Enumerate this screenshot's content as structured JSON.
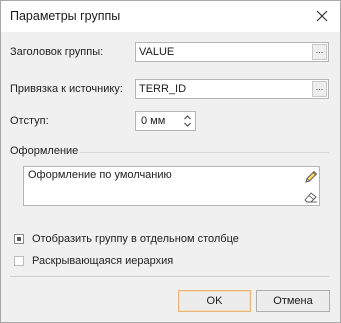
{
  "window": {
    "title": "Параметры группы"
  },
  "form": {
    "group_header": {
      "label": "Заголовок группы:",
      "value": "VALUE",
      "button": "..."
    },
    "source_binding": {
      "label": "Привязка к источнику:",
      "value": "TERR_ID",
      "button": "..."
    },
    "indent": {
      "label": "Отступ:",
      "value": "0 мм"
    },
    "appearance": {
      "section_label": "Оформление",
      "value": "Оформление по умолчанию"
    },
    "show_in_separate_column": {
      "label": "Отобразить группу в отдельном столбце",
      "checked": true
    },
    "expandable_hierarchy": {
      "label": "Раскрывающаяся иерархия",
      "checked": false
    }
  },
  "buttons": {
    "ok": "OK",
    "cancel": "Отмена"
  },
  "colors": {
    "dialog_bg": "#f0f0f0",
    "default_button_border": "#e8b57a"
  }
}
